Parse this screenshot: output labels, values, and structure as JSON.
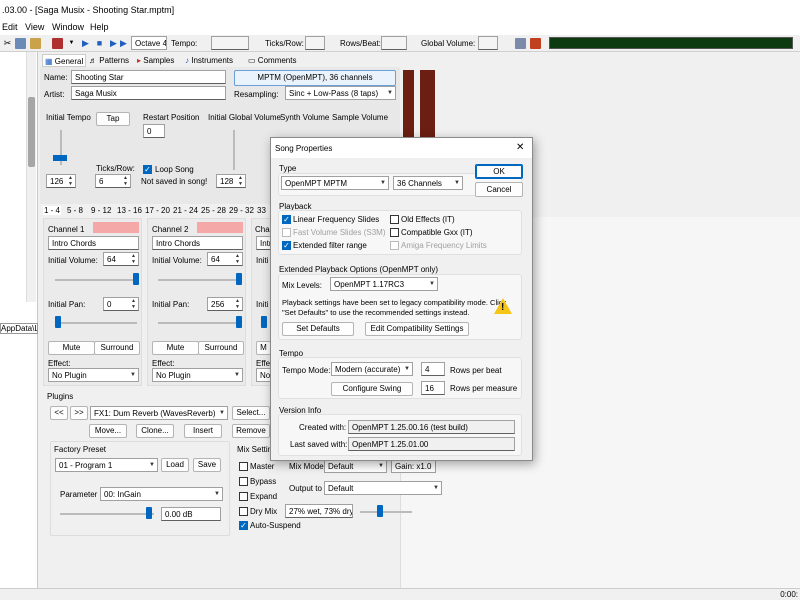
{
  "window": {
    "title": ".03.00 - [Saga Musix - Shooting Star.mptm]"
  },
  "menu": [
    "Edit",
    "View",
    "Window",
    "Help"
  ],
  "toolbar": {
    "octave": "Octave 4",
    "tempo_label": "Tempo:",
    "ticks_label": "Ticks/Row:",
    "rows_beat_label": "Rows/Beat:",
    "global_volume_label": "Global Volume:"
  },
  "tabs": [
    "General",
    "Patterns",
    "Samples",
    "Instruments",
    "Comments"
  ],
  "general": {
    "name_label": "Name:",
    "name_value": "Shooting Star",
    "artist_label": "Artist:",
    "artist_value": "Saga Musix",
    "format_button": "MPTM (OpenMPT), 36 channels",
    "resampling_label": "Resampling:",
    "resampling_value": "Sinc + Low-Pass (8 taps)",
    "initial_tempo_label": "Initial Tempo",
    "tap_button": "Tap",
    "restart_position_label": "Restart Position",
    "restart_position_value": "0",
    "initial_global_volume_label": "Initial Global Volume",
    "synth_volume_label": "Synth Volume",
    "sample_volume_label": "Sample Volume",
    "tempo_value": "126",
    "ticks_row_label": "Ticks/Row:",
    "ticks_row_value": "6",
    "loop_song_label": "Loop Song",
    "not_saved_label": "Not saved in song!",
    "global_volume_value": "128"
  },
  "channel_tabs": [
    "1 - 4",
    "5 - 8",
    "9 - 12",
    "13 - 16",
    "17 - 20",
    "21 - 24",
    "25 - 28",
    "29 - 32",
    "33"
  ],
  "channels": [
    {
      "title": "Channel 1",
      "name": "Intro Chords",
      "volume_label": "Initial Volume:",
      "volume": "64",
      "pan_label": "Initial Pan:",
      "pan": "0",
      "mute": "Mute",
      "surround": "Surround",
      "effect_label": "Effect:",
      "effect": "No Plugin"
    },
    {
      "title": "Channel 2",
      "name": "Intro Chords",
      "volume_label": "Initial Volume:",
      "volume": "64",
      "pan_label": "Initial Pan:",
      "pan": "256",
      "mute": "Mute",
      "surround": "Surround",
      "effect_label": "Effect:",
      "effect": "No Plugin"
    }
  ],
  "channel3": {
    "title": "Cha",
    "name": "Intr",
    "volume_label": "Initi",
    "pan_label": "Initi",
    "mute": "M",
    "effect_label": "Effe",
    "effect": "No"
  },
  "plugins": {
    "section_label": "Plugins",
    "prev": "<<",
    "next": ">>",
    "current": "FX1: Dum Reverb (WavesReverb)",
    "select": "Select...",
    "move": "Move...",
    "clone": "Clone...",
    "insert": "Insert",
    "remove": "Remove",
    "factory_preset_label": "Factory Preset",
    "preset_value": "01 - Program 1",
    "load": "Load",
    "save": "Save",
    "parameter_label": "Parameter",
    "parameter_value": "00: InGain",
    "parameter_display": "0.00 dB",
    "mix_settings_label": "Mix Settin",
    "master": "Master",
    "bypass": "Bypass",
    "expand": "Expand",
    "dry_mix": "Dry Mix",
    "auto_suspend": "Auto-Suspend",
    "mix_mode_label": "Mix Mode",
    "mix_mode_value": "Default",
    "gain_value": "Gain: x1.0",
    "output_to_label": "Output to",
    "output_to_value": "Default",
    "wet_dry": "27% wet, 73% dry"
  },
  "left_pane": {
    "path_text": "AppData\\Lc"
  },
  "status": {
    "right_text": "0:00:"
  },
  "dialog": {
    "title": "Song Properties",
    "close": "✕",
    "ok": "OK",
    "cancel": "Cancel",
    "type_label": "Type",
    "type_value": "OpenMPT MPTM",
    "channels_value": "36 Channels",
    "playback_label": "Playback",
    "linear_freq": "Linear Frequency Slides",
    "fast_volume": "Fast Volume Slides (S3M)",
    "extended_filter": "Extended filter range",
    "old_effects": "Old Effects (IT)",
    "compatible_gxx": "Compatible Gxx (IT)",
    "amiga_freq": "Amiga Frequency Limits",
    "extended_playback_label": "Extended Playback Options (OpenMPT only)",
    "mix_levels_label": "Mix Levels:",
    "mix_levels_value": "OpenMPT 1.17RC3",
    "legacy_line1": "Playback settings have been set to legacy compatibility mode. Click",
    "legacy_line2": "\"Set Defaults\" to use the recommended settings instead.",
    "set_defaults": "Set Defaults",
    "edit_compat": "Edit Compatibility Settings",
    "tempo_label": "Tempo",
    "tempo_mode_label": "Tempo Mode:",
    "tempo_mode_value": "Modern (accurate)",
    "rows_per_beat_value": "4",
    "rows_per_beat_label": "Rows per beat",
    "configure_swing": "Configure Swing",
    "rows_per_measure_value": "16",
    "rows_per_measure_label": "Rows per measure",
    "version_label": "Version Info",
    "created_label": "Created with:",
    "created_value": "OpenMPT 1.25.00.16 (test build)",
    "saved_label": "Last saved with:",
    "saved_value": "OpenMPT 1.25.01.00"
  },
  "colors": {
    "accent": "#0067c0",
    "channel_color": "#f4a8a8",
    "vu_meter": "#0e3a12",
    "pattern_bar": "#6b1e12"
  }
}
